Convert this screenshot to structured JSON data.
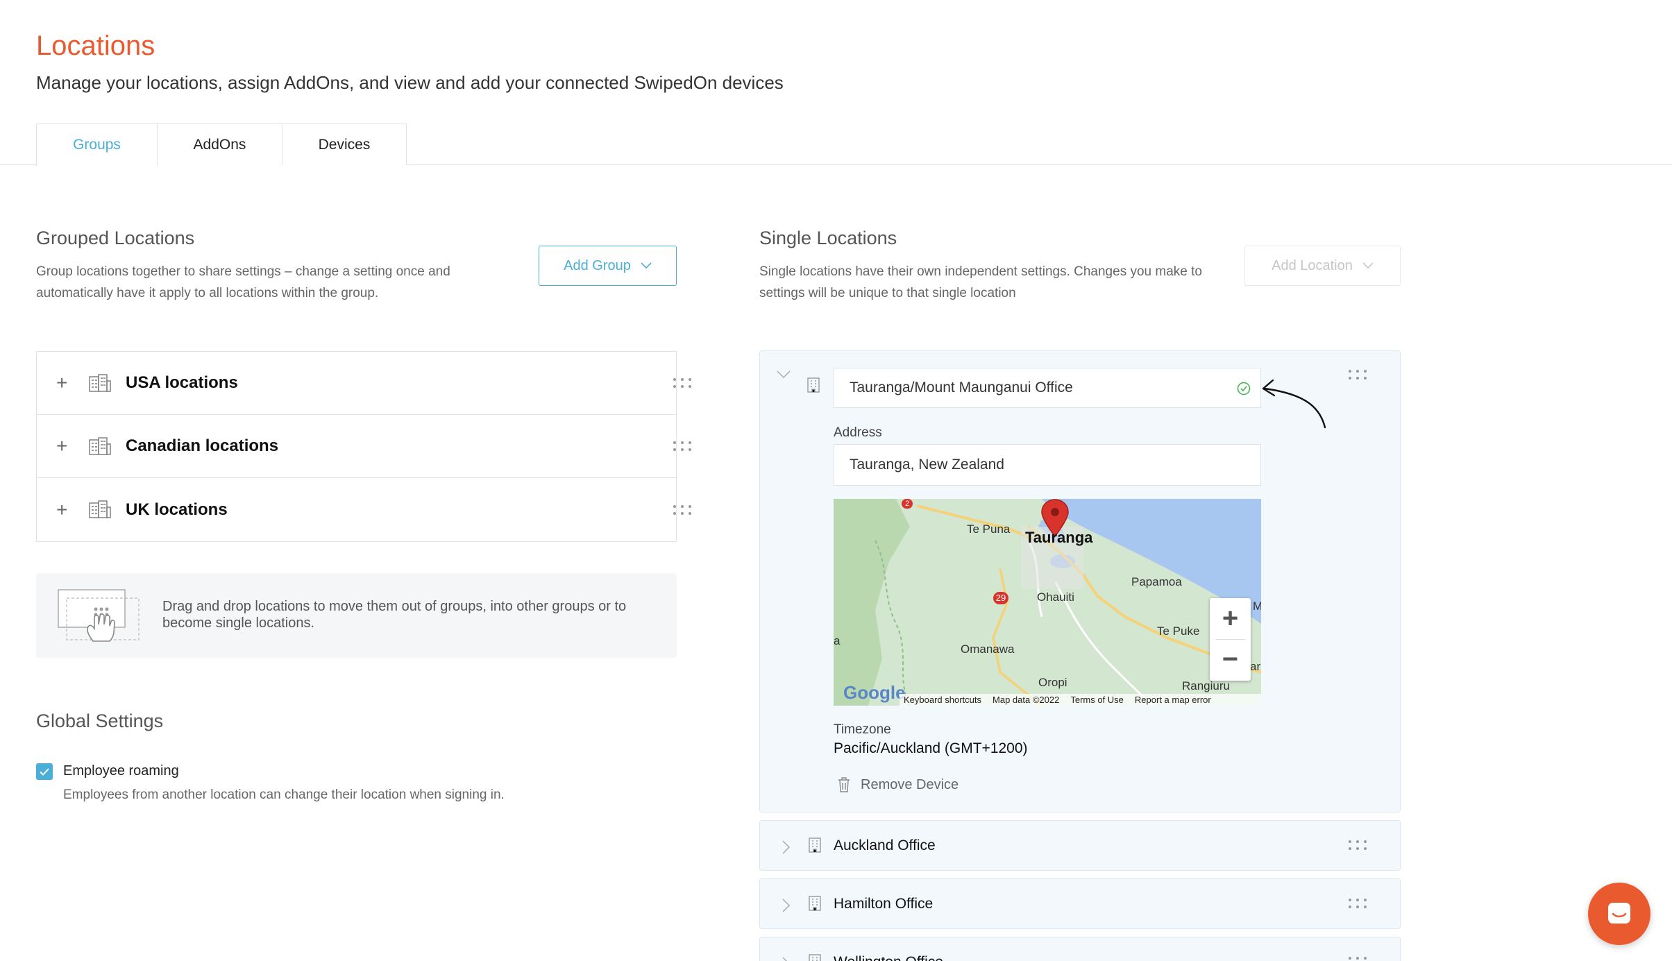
{
  "header": {
    "title": "Locations",
    "subtitle": "Manage your locations, assign AddOns, and view and add your connected SwipedOn devices"
  },
  "tabs": [
    {
      "label": "Groups",
      "active": true
    },
    {
      "label": "AddOns",
      "active": false
    },
    {
      "label": "Devices",
      "active": false
    }
  ],
  "grouped": {
    "title": "Grouped Locations",
    "description": "Group locations together to share settings – change a setting once and automatically have it apply to all locations within the group.",
    "add_button": "Add Group",
    "groups": [
      {
        "label": "USA locations"
      },
      {
        "label": "Canadian locations"
      },
      {
        "label": "UK locations"
      }
    ],
    "hint": "Drag and drop locations to move them out of groups, into other groups or to become single locations."
  },
  "global_settings": {
    "title": "Global Settings",
    "employee_roaming": {
      "label": "Employee roaming",
      "description": "Employees from another location can change their location when signing in.",
      "checked": true
    }
  },
  "single": {
    "title": "Single Locations",
    "description": "Single locations have their own independent settings. Changes you make to settings will be unique to that single location",
    "add_button": "Add Location",
    "expanded": {
      "name": "Tauranga/Mount Maunganui Office",
      "address_label": "Address",
      "address_value": "Tauranga, New Zealand",
      "timezone_label": "Timezone",
      "timezone_value": "Pacific/Auckland (GMT+1200)",
      "remove_label": "Remove Device"
    },
    "others": [
      {
        "label": "Auckland Office"
      },
      {
        "label": "Hamilton Office"
      },
      {
        "label": "Wellington Office"
      }
    ]
  },
  "map": {
    "labels": {
      "tauranga": "Tauranga",
      "te_puna": "Te Puna",
      "papamoa": "Papamoa",
      "ohauiti": "Ohauiti",
      "te_puke": "Te Puke",
      "omanawa": "Omanawa",
      "oropi": "Oropi",
      "rangiuru": "Rangiuru",
      "route_29": "29",
      "route_2": "2",
      "edge_a": "a",
      "edge_m": "M",
      "edge_ar": "ar"
    },
    "zoom_in": "+",
    "zoom_out": "−",
    "logo": "Google",
    "footer": {
      "shortcuts": "Keyboard shortcuts",
      "data": "Map data ©2022",
      "terms": "Terms of Use",
      "report": "Report a map error"
    }
  },
  "colors": {
    "brand": "#ea5a2f",
    "accent": "#4aaed6",
    "valid": "#3bb54a"
  }
}
